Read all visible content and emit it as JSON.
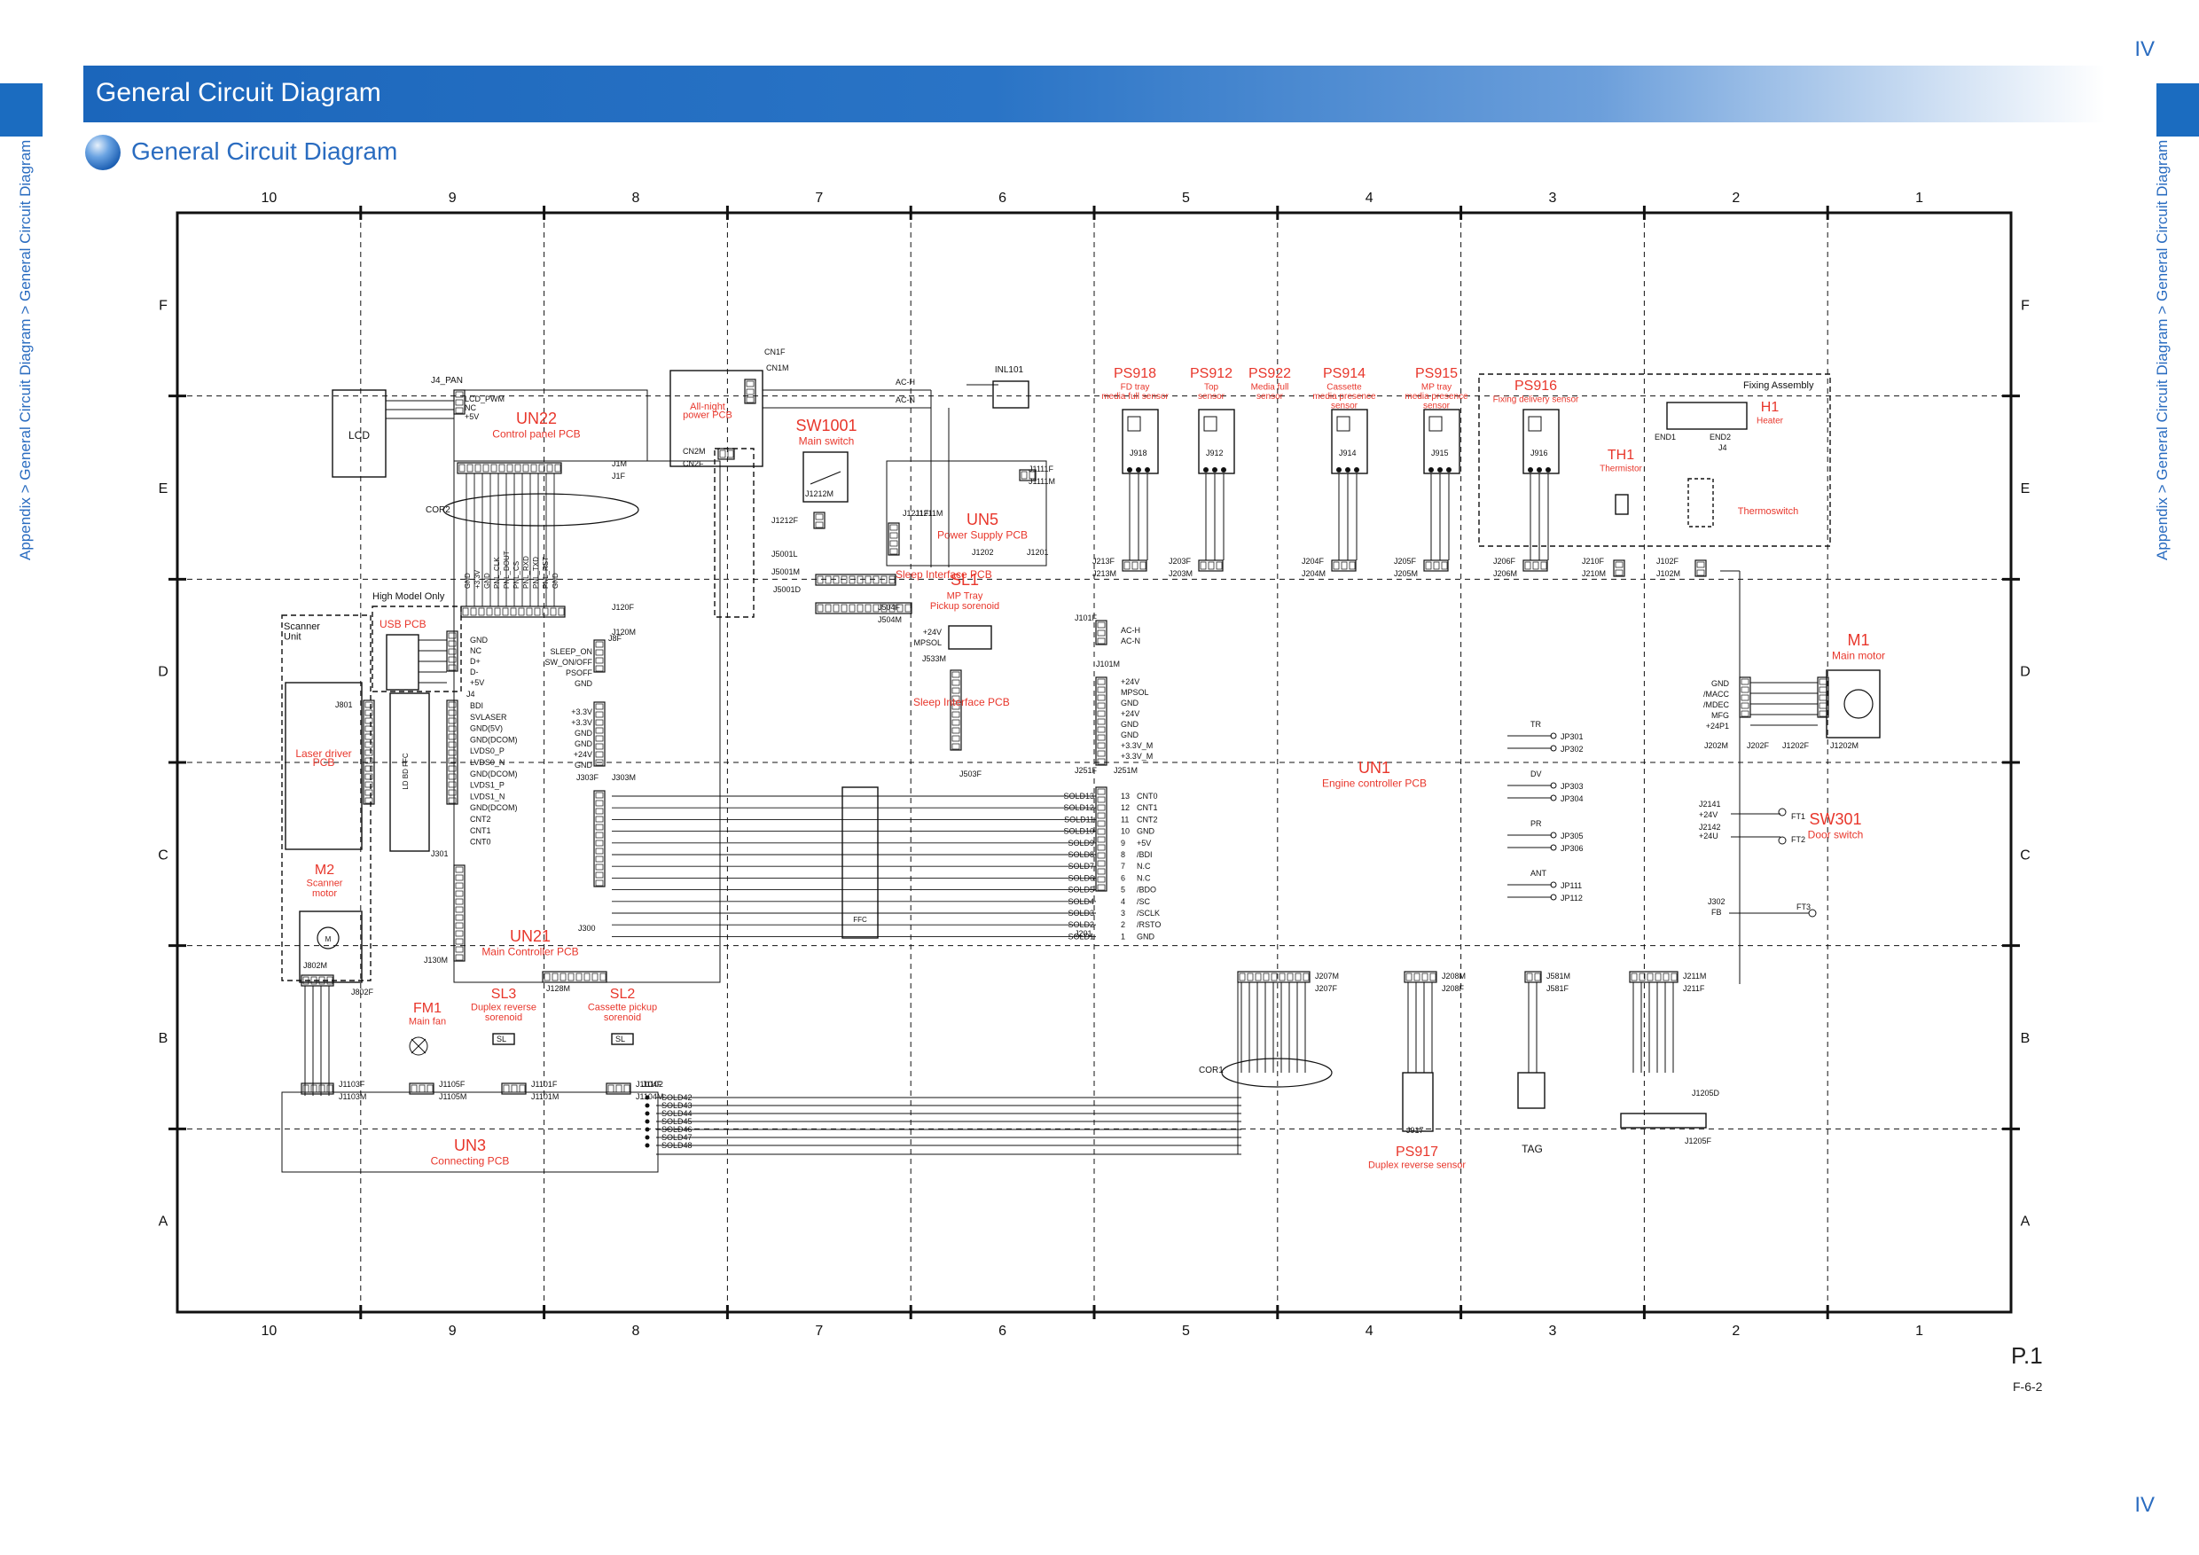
{
  "chapter": "IV",
  "header": {
    "title": "General Circuit Diagram",
    "section_title": "General Circuit Diagram"
  },
  "breadcrumb": "Appendix > General Circuit Diagram > General Circuit Diagram",
  "footer": {
    "page": "P.1",
    "figure": "F-6-2"
  },
  "grid": {
    "cols": [
      "10",
      "9",
      "8",
      "7",
      "6",
      "5",
      "4",
      "3",
      "2",
      "1"
    ],
    "rows": [
      "F",
      "E",
      "D",
      "C",
      "B",
      "A"
    ]
  },
  "colors": {
    "accent": "#1b6cc0",
    "label_red": "#e8362b",
    "line": "#111111"
  },
  "components": [
    {
      "id": "UN22",
      "desc": "Control panel PCB"
    },
    {
      "id": "All-night",
      "desc": "power PCB"
    },
    {
      "id": "SW1001",
      "desc": "Main switch"
    },
    {
      "id": "UN5",
      "desc": "Power Supply PCB"
    },
    {
      "id": "SL1",
      "desc": "MP Tray\nPickup sorenoid"
    },
    {
      "id": "PS918",
      "desc": "FD tray\nmedia full sensor"
    },
    {
      "id": "PS912",
      "desc": "Top\nsensor"
    },
    {
      "id": "PS922",
      "desc": "Media full\nsensor"
    },
    {
      "id": "PS914",
      "desc": "Cassette\nmedia presence\nsensor"
    },
    {
      "id": "PS915",
      "desc": "MP tray\nmedia presence\nsensor"
    },
    {
      "id": "PS916",
      "desc": "Fixing delivery sensor"
    },
    {
      "id": "TH1",
      "desc": "Thermistor"
    },
    {
      "id": "H1",
      "desc": "Heater"
    },
    {
      "id": "Thermoswitch",
      "desc": ""
    },
    {
      "id": "M1",
      "desc": "Main motor"
    },
    {
      "id": "SW301",
      "desc": "Door switch"
    },
    {
      "id": "UN1",
      "desc": "Engine controller PCB"
    },
    {
      "id": "USB PCB",
      "desc": ""
    },
    {
      "id": "Laser driver",
      "desc": "PCB"
    },
    {
      "id": "M2",
      "desc": "Scanner\nmotor"
    },
    {
      "id": "UN21",
      "desc": "Main Controller PCB"
    },
    {
      "id": "FM1",
      "desc": "Main fan"
    },
    {
      "id": "SL3",
      "desc": "Duplex reverse\nsorenoid"
    },
    {
      "id": "SL2",
      "desc": "Cassette pickup\nsorenoid"
    },
    {
      "id": "UN3",
      "desc": "Connecting PCB"
    },
    {
      "id": "PS917",
      "desc": "Duplex reverse sensor"
    },
    {
      "id": "Sleep Interface PCB",
      "desc": ""
    }
  ],
  "plain_labels": {
    "lcd": "LCD",
    "j4_pan": "J4_PAN",
    "cor2": "COR2",
    "cor1": "COR1",
    "high_model": "High Model Only",
    "scanner_unit": "Scanner\nUnit",
    "fixing_assembly": "Fixing Assembly",
    "ffc": "FFC",
    "ld_bd_ffc": "LD BD FFC",
    "inl101": "INL101",
    "tag": "TAG",
    "end1": "END1",
    "end2": "END2"
  },
  "connectors": [
    "J1M",
    "J1F",
    "J120F",
    "J120M",
    "J8F",
    "J531F",
    "J531M",
    "J502M",
    "J502F",
    "J532M",
    "J532F",
    "J303M",
    "J303F",
    "J300",
    "J301",
    "J130M",
    "J128M",
    "J1103F",
    "J1103M",
    "J1105F",
    "J1105M",
    "J1101F",
    "J1101M",
    "J1104F",
    "J1104M",
    "J1102",
    "J802F",
    "J802M",
    "J801",
    "J4",
    "CN2M",
    "CN2F",
    "CN1M",
    "CN1F",
    "J1212M",
    "J1212F",
    "J5001L",
    "J5001M",
    "J5001D",
    "J504F",
    "J504M",
    "J1211F",
    "J1211M",
    "J1111F",
    "J1111M",
    "J1202",
    "J1201",
    "J213F",
    "J213M",
    "J101F",
    "J101M",
    "J533M",
    "J503F",
    "J251F",
    "J251M",
    "J201",
    "J203F",
    "J203M",
    "J204F",
    "J204M",
    "J205F",
    "J205M",
    "J206F",
    "J206M",
    "J210F",
    "J210M",
    "J102F",
    "J102M",
    "J918",
    "J912",
    "J914",
    "J915",
    "J916",
    "J917",
    "J202M",
    "J202F",
    "J1202F",
    "J1202M",
    "J2141",
    "J2142",
    "J302",
    "J207M",
    "J207F",
    "J208M",
    "J208F",
    "J581M",
    "J581F",
    "J211M",
    "J211F",
    "J1205D",
    "J1205F",
    "JP301",
    "JP302",
    "JP303",
    "JP304",
    "JP305",
    "JP306",
    "JP111",
    "JP112"
  ],
  "signals": {
    "lcd_if": [
      "LCD_PWM",
      "NC",
      "+5V"
    ],
    "usb": [
      "GND",
      "NC",
      "D+",
      "D-",
      "+5V"
    ],
    "laser": [
      "BDI",
      "SVLASER",
      "GND(5V)",
      "GND(DCOM)",
      "LVDS0_P",
      "LVDS0_N",
      "GND(DCOM)",
      "LVDS1_P",
      "LVDS1_N",
      "GND(DCOM)",
      "CNT2",
      "CNT1",
      "CNT0"
    ],
    "panel_bus": [
      "GND",
      "+3.3V",
      "GND",
      "PNL_CLK",
      "PNL_DOUT",
      "PNL_CS",
      "PNL_RXD",
      "PNL_TXD",
      "PNL_RST",
      "GND"
    ],
    "sleep": [
      "SLEEP_ON",
      "SW_ON/OFF",
      "PSOFF",
      "GND"
    ],
    "power_j303": [
      "+3.3V",
      "+3.3V",
      "GND",
      "GND",
      "+24V",
      "GND"
    ],
    "engine_j251": [
      "+24V",
      "MPSOL",
      "GND",
      "+24V",
      "GND",
      "GND",
      "+3.3V_M",
      "+3.3V_M"
    ],
    "ffc_left": [
      "SOLD13",
      "SOLD12",
      "SOLD11",
      "SOLD10",
      "SOLD9",
      "SOLD8",
      "SOLD7",
      "SOLD6",
      "SOLD5",
      "SOLD4",
      "SOLD3",
      "SOLD2",
      "SOLD1"
    ],
    "ffc_right": [
      "CNT0",
      "CNT1",
      "CNT2",
      "GND",
      "+5V",
      "/BDI",
      "N.C",
      "N.C",
      "/BDO",
      "/SC",
      "/SCLK",
      "/RSTO",
      "GND"
    ],
    "ffc_pins": [
      "13",
      "12",
      "11",
      "10",
      "9",
      "8",
      "7",
      "6",
      "5",
      "4",
      "3",
      "2",
      "1"
    ],
    "motor": [
      "GND",
      "/MACC",
      "/MDEC",
      "MFG",
      "+24P1"
    ],
    "ac": [
      "AC-H",
      "AC-N"
    ],
    "mp_sol": [
      "+24V",
      "MPSOL"
    ],
    "j1102": [
      "SOLD42",
      "SOLD43",
      "SOLD44",
      "SOLD45",
      "SOLD46",
      "SOLD47",
      "SOLD48"
    ],
    "door": [
      "+24V",
      "+24U"
    ],
    "jumpers": [
      "TR",
      "DV",
      "PR",
      "ANT"
    ],
    "ft": [
      "FT1",
      "FT2",
      "FT3",
      "FB"
    ]
  }
}
